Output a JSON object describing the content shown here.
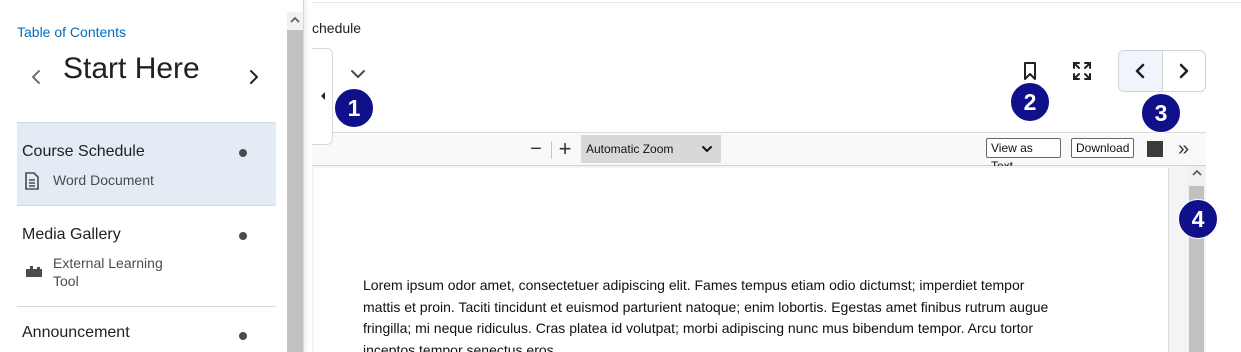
{
  "main": {
    "breadcrumb": "chedule",
    "doc_text": "Lorem ipsum odor amet, consectetuer adipiscing elit. Fames tempus etiam odio dictumst; imperdiet tempor mattis et proin. Taciti tincidunt et euismod parturient natoque; enim lobortis. Egestas amet finibus rutrum augue fringilla; mi neque ridiculus. Cras platea id volutpat; morbi adipiscing nunc mus bibendum tempor. Arcu tortor inceptos tempor senectus eros."
  },
  "pdf_toolbar": {
    "zoom_out": "−",
    "zoom_in": "+",
    "zoom_value": "Automatic Zoom",
    "view_as_text": "View as Text",
    "download": "Download",
    "more": "»"
  },
  "badges": [
    "1",
    "2",
    "3",
    "4"
  ],
  "sidebar": {
    "toc_link": "Table of Contents",
    "unit_title": "Start Here",
    "items": [
      {
        "title": "Course Schedule",
        "type": "Word Document",
        "icon": "document-icon",
        "active": true
      },
      {
        "title": "Media Gallery",
        "type": "External Learning Tool",
        "icon": "puzzle-icon",
        "active": false
      },
      {
        "title": "Announcement",
        "type": "",
        "icon": "",
        "active": false
      }
    ]
  },
  "colors": {
    "accent_link": "#006fbf",
    "badge": "#10108a",
    "active_item": "#e3ebf5"
  },
  "icons": [
    "chevron-down-icon",
    "collapse-left-icon",
    "bookmark-icon",
    "fullscreen-icon",
    "chevron-left-icon",
    "chevron-right-icon"
  ]
}
